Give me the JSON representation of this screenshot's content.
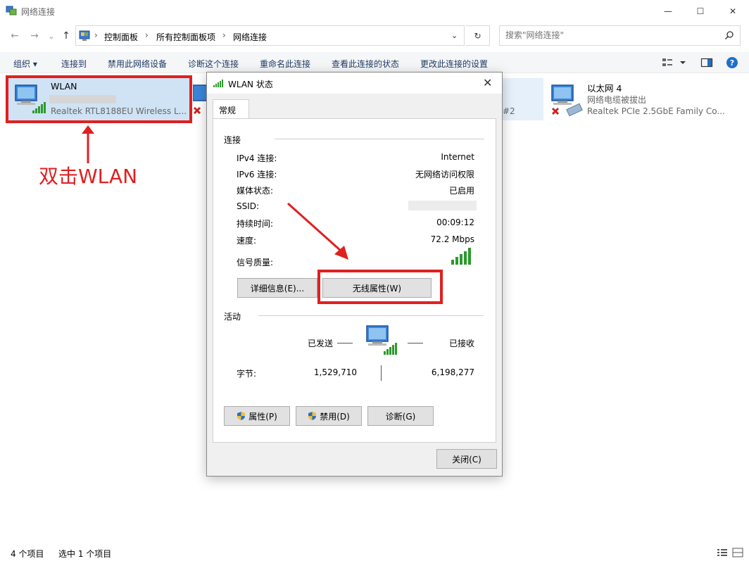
{
  "window": {
    "title": "网络连接",
    "minimize": "—",
    "maximize": "☐",
    "close": "✕"
  },
  "nav": {
    "back": "←",
    "forward": "→",
    "recent": "⌄",
    "up": "↑",
    "breadcrumbs": [
      "控制面板",
      "所有控制面板项",
      "网络连接"
    ],
    "separator": "›",
    "dropdown": "⌄",
    "refresh": "↻",
    "search_placeholder": "搜索\"网络连接\""
  },
  "commandbar": {
    "organize": "组织 ▾",
    "connect_to": "连接到",
    "disable_device": "禁用此网络设备",
    "diagnose": "诊断这个连接",
    "rename": "重命名此连接",
    "view_status": "查看此连接的状态",
    "change_settings": "更改此连接的设置"
  },
  "items": [
    {
      "name": "WLAN",
      "device": "Realtek RTL8188EU Wireless L..."
    },
    {
      "name": "",
      "device": "#2"
    },
    {
      "name": "以太网 4",
      "status": "网络电缆被拔出",
      "device": "Realtek PCIe 2.5GbE Family Co..."
    }
  ],
  "annotation": "双击WLAN",
  "statusbar": {
    "count": "4 个项目",
    "selected": "选中 1 个项目"
  },
  "dialog": {
    "title": "WLAN 状态",
    "close": "✕",
    "tab": "常规",
    "connection_group": "连接",
    "rows": [
      {
        "label": "IPv4 连接:",
        "value": "Internet"
      },
      {
        "label": "IPv6 连接:",
        "value": "无网络访问权限"
      },
      {
        "label": "媒体状态:",
        "value": "已启用"
      },
      {
        "label": "SSID:",
        "value": ""
      },
      {
        "label": "持续时间:",
        "value": "00:09:12"
      },
      {
        "label": "速度:",
        "value": "72.2 Mbps"
      },
      {
        "label": "信号质量:",
        "value": ""
      }
    ],
    "details_button": "详细信息(E)...",
    "wireless_button": "无线属性(W)",
    "activity_group": "活动",
    "sent_label": "已发送",
    "received_label": "已接收",
    "bytes_label": "字节:",
    "bytes_sent": "1,529,710",
    "bytes_received": "6,198,277",
    "properties_button": "属性(P)",
    "disable_button": "禁用(D)",
    "diagnose_button": "诊断(G)",
    "close_button": "关闭(C)"
  },
  "colors": {
    "annotation_red": "#e02020",
    "selection_blue": "#cfe3f5",
    "link_text": "#1e3a66"
  }
}
